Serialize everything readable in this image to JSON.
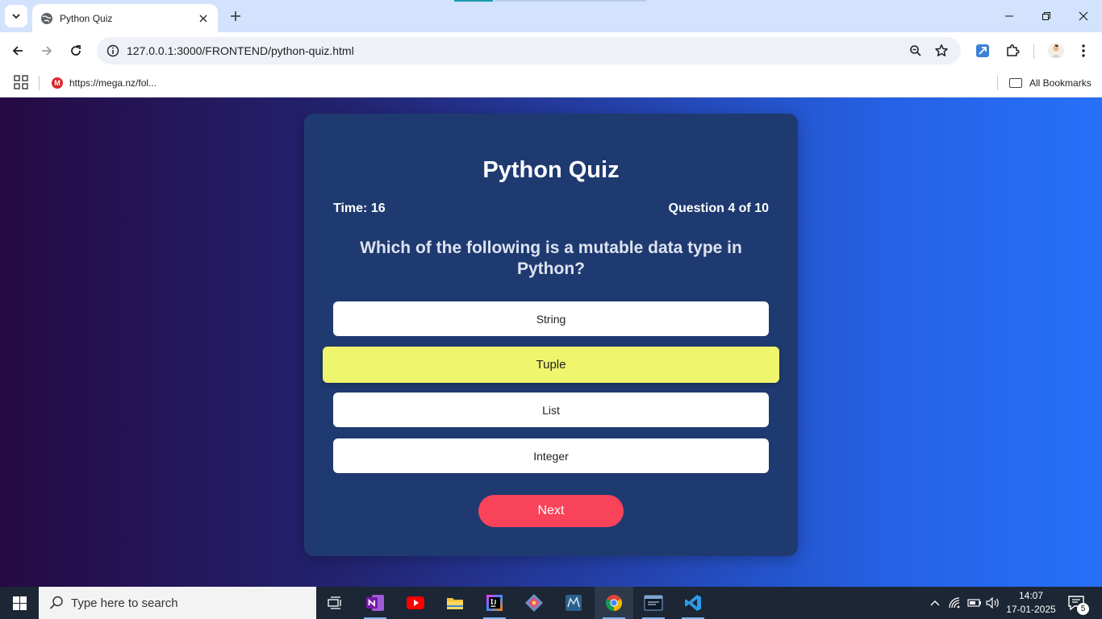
{
  "browser": {
    "tab": {
      "title": "Python Quiz"
    },
    "address": {
      "url": "127.0.0.1:3000/FRONTEND/python-quiz.html"
    },
    "bookmarks": {
      "items": [
        {
          "label": "https://mega.nz/fol...",
          "favicon_letter": "M"
        }
      ],
      "all_bookmarks_label": "All Bookmarks"
    }
  },
  "quiz": {
    "title": "Python Quiz",
    "timer": "Time: 16",
    "progress": "Question 4 of 10",
    "question": "Which of the following is a mutable data type in Python?",
    "options": [
      {
        "label": "String"
      },
      {
        "label": "Tuple"
      },
      {
        "label": "List"
      },
      {
        "label": "Integer"
      }
    ],
    "next_label": "Next"
  },
  "taskbar": {
    "search_placeholder": "Type here to search",
    "time": "14:07",
    "date": "17-01-2025",
    "notification_count": "5"
  },
  "colors": {
    "card_bg": "#1f3a70",
    "option_highlight": "#eff56d",
    "next_button": "#f9435a",
    "gradient_start": "#250a44",
    "gradient_end": "#2670f8"
  }
}
